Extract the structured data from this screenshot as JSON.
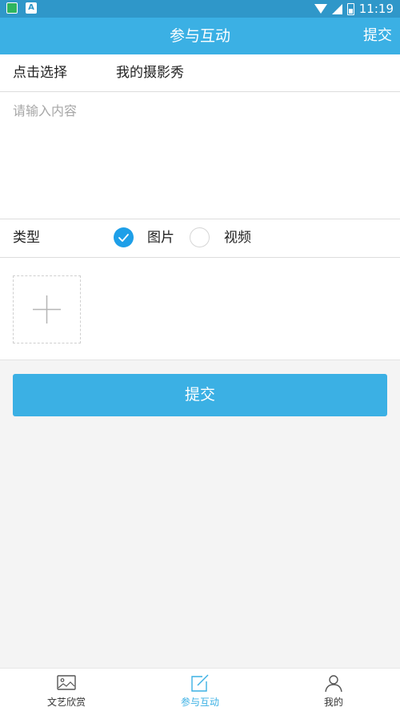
{
  "status_bar": {
    "time": "11:19",
    "icons": [
      "app-store-icon",
      "a-notification-icon",
      "wifi-icon",
      "signal-icon",
      "battery-icon"
    ]
  },
  "app_bar": {
    "title": "参与互动",
    "submit_label": "提交",
    "background": "#3bb0e4"
  },
  "form": {
    "select_label": "点击选择",
    "select_value": "我的摄影秀",
    "content_placeholder": "请输入内容",
    "content_value": "",
    "type_label": "类型",
    "type_options": [
      {
        "label": "图片",
        "checked": true
      },
      {
        "label": "视频",
        "checked": false
      }
    ],
    "add_icon": "plus-icon",
    "submit_button": "提交"
  },
  "bottom_nav": {
    "items": [
      {
        "label": "文艺欣赏",
        "icon": "image-icon",
        "active": false
      },
      {
        "label": "参与互动",
        "icon": "edit-icon",
        "active": true
      },
      {
        "label": "我的",
        "icon": "user-icon",
        "active": false
      }
    ],
    "active_color": "#3bb0e4"
  }
}
